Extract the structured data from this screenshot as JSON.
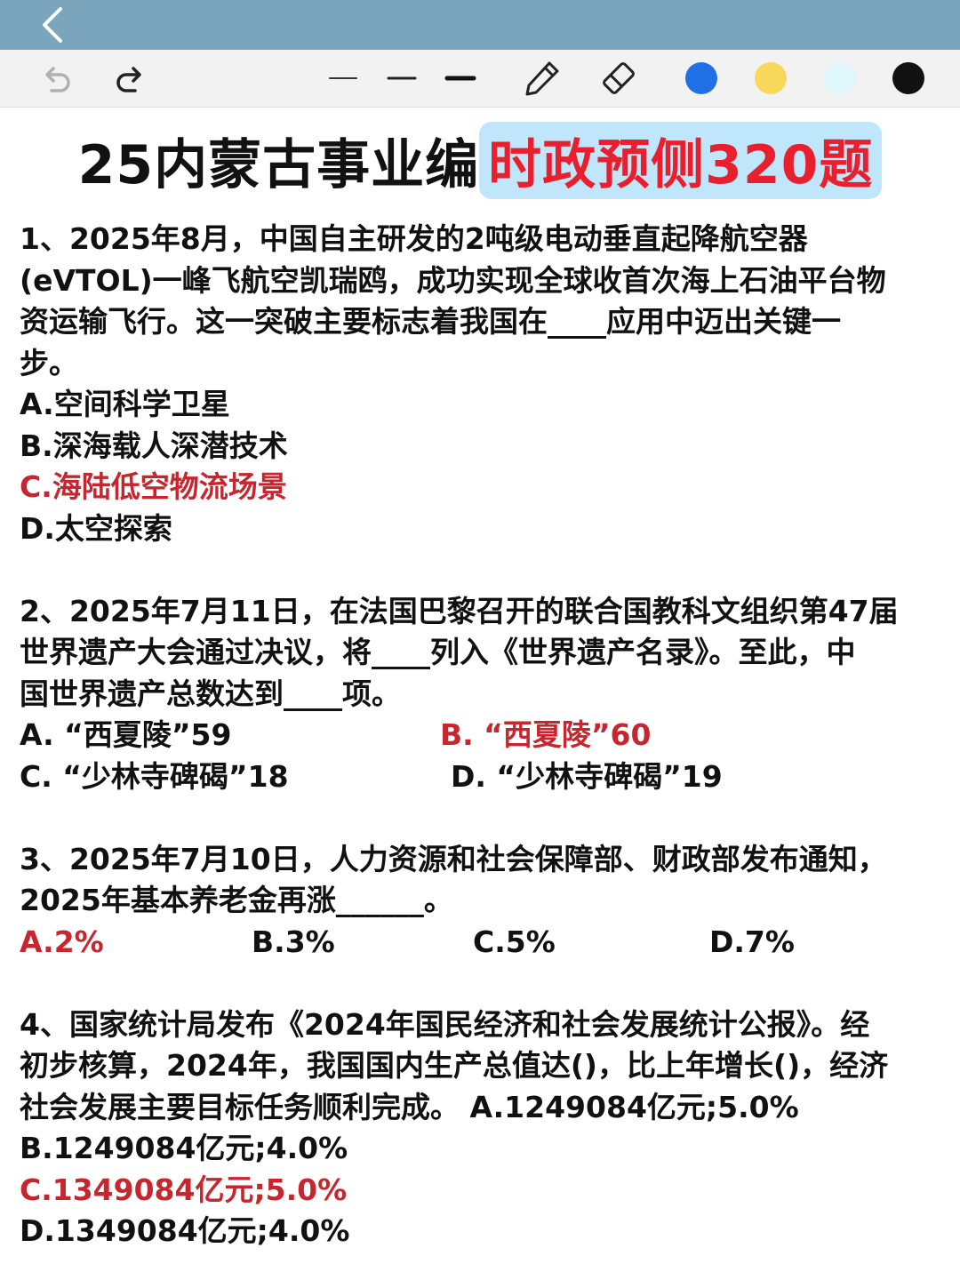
{
  "title": {
    "part1": "25内蒙古事业编",
    "part2": "时政预侧320题"
  },
  "colors": {
    "topbar": "#7ba4bd",
    "blue": "#1f6fe5",
    "yellow": "#f9d75a",
    "cyan": "#dff6fb",
    "black": "#111111",
    "answer_red": "#c6262e",
    "title_red": "#e8202e",
    "highlight": "#bfe6fb"
  },
  "toolbar": {
    "icons": [
      "back-icon",
      "undo-icon",
      "redo-icon",
      "thin-line-icon",
      "medium-line-icon",
      "thick-line-icon",
      "pen-icon",
      "eraser-icon"
    ]
  },
  "q1": {
    "stem": [
      "1、2025年8月，中国自主研发的2吨级电动垂直起降航空器",
      "(eVTOL)一峰飞航空凯瑞鸥，成功实现全球收首次海上石油平台物",
      "资运输飞行。这一突破主要标志着我国在____应用中迈出关键一",
      "步。"
    ],
    "a": "A.空间科学卫星",
    "b": "B.深海载人深潜技术",
    "c": "C.海陆低空物流场景",
    "d": "D.太空探索"
  },
  "q2": {
    "stem": [
      "2、2025年7月11日，在法国巴黎召开的联合国教科文组织第47届",
      "世界遗产大会通过决议，将____列入《世界遗产名录》。至此，中",
      "国世界遗产总数达到____项。"
    ],
    "a": "A. “西夏陵”59",
    "b": "B. “西夏陵”60",
    "c": "C. “少林寺碑碣”18",
    "d": "D. “少林寺碑碣”19"
  },
  "q3": {
    "stem": [
      "3、2025年7月10日，人力资源和社会保障部、财政部发布通知，",
      "2025年基本养老金再涨______。"
    ],
    "a": "A.2%",
    "b": "B.3%",
    "c": "C.5%",
    "d": "D.7%"
  },
  "q4": {
    "stem": [
      "4、国家统计局发布《2024年国民经济和社会发展统计公报》。经",
      "初步核算，2024年，我国国内生产总值达()，比上年增长()，经济",
      "社会发展主要目标任务顺利完成。 A.1249084亿元;5.0%"
    ],
    "b": "B.1249084亿元;4.0%",
    "c": "C.1349084亿元;5.0%",
    "d": "D.1349084亿元;4.0%"
  }
}
